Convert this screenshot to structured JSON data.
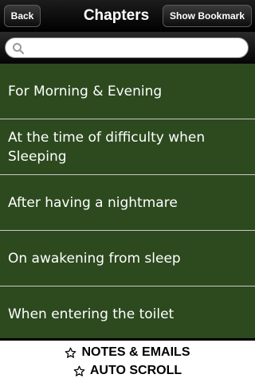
{
  "navbar": {
    "back_label": "Back",
    "title": "Chapters",
    "bookmark_label": "Show Bookmark"
  },
  "search": {
    "placeholder": "",
    "value": ""
  },
  "chapters": [
    {
      "label": "For Morning & Evening"
    },
    {
      "label": "At the time of difficulty when Sleeping"
    },
    {
      "label": "After having a nightmare"
    },
    {
      "label": "On awakening from sleep"
    },
    {
      "label": "When entering the toilet"
    }
  ],
  "footer": {
    "notes_label": "NOTES & EMAILS",
    "scroll_label": "AUTO SCROLL",
    "icon": "star-icon"
  },
  "colors": {
    "list_background": "#2d4a1f",
    "navbar_background": "#000000"
  }
}
